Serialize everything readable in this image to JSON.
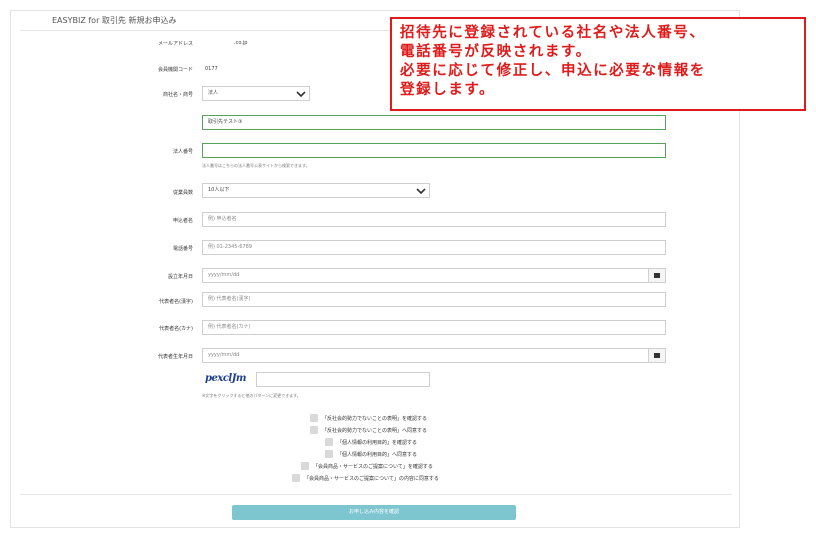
{
  "page": {
    "title": "EASYBIZ for 取引先 新規お申込み"
  },
  "form": {
    "email": {
      "label": "メールアドレス",
      "value": ".co.jp"
    },
    "member_code": {
      "label": "会員機関コード",
      "value": "0177"
    },
    "company": {
      "label": "商社名・商号",
      "type_value": "法人",
      "name_value": "取引先テスト③"
    },
    "corp_number": {
      "label": "法人番号",
      "value": "",
      "hint": "法人番号はこちらの法人番号公表サイトから検索できます。"
    },
    "employees": {
      "label": "従業員数",
      "value": "10人以下"
    },
    "applicant_name": {
      "label": "申込者名",
      "placeholder": "例) 申込者名"
    },
    "phone": {
      "label": "電話番号",
      "placeholder": "例) 01-2345-6789"
    },
    "founded": {
      "label": "設立年月日",
      "placeholder": "yyyy/mm/dd"
    },
    "rep_name_kanji": {
      "label": "代表者名(漢字)",
      "placeholder": "例) 代表者名(漢字)"
    },
    "rep_name_kana": {
      "label": "代表者名(カナ)",
      "placeholder": "例) 代表者名(カナ)"
    },
    "rep_birthdate": {
      "label": "代表者生年月日",
      "placeholder": "yyyy/mm/dd"
    },
    "captcha": {
      "image_text": "pexclJm",
      "value": "",
      "hint": "※文字をクリックすると他のパターンに変更できます。"
    },
    "agreements": [
      "「反社会的勢力でないことの表明」を確認する",
      "「反社会的勢力でないことの表明」へ同意する",
      "「個人情報の利用目的」を確認する",
      "「個人情報の利用目的」へ同意する",
      "「会員商品・サービスのご提案について」を確認する",
      "「会員商品・サービスのご提案について」の内容に同意する"
    ],
    "submit_label": "お申し込み内容を確認"
  },
  "callout": {
    "lines": [
      "招待先に登録されている社名や法人番号、",
      "電話番号が反映されます。",
      "必要に応じて修正し、申込に必要な情報を",
      "登録します。"
    ],
    "color": "#e01b1b"
  },
  "colors": {
    "accent_button": "#7ec6cf",
    "prefilled_border": "#5aa25a"
  }
}
